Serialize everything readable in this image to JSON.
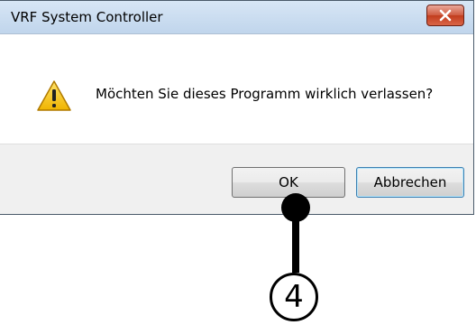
{
  "window": {
    "title": "VRF System Controller",
    "close_icon": "close-x-icon"
  },
  "dialog": {
    "icon": "warning-triangle-icon",
    "message": "Möchten Sie dieses Programm wirklich verlassen?"
  },
  "buttons": {
    "ok_label": "OK",
    "cancel_label": "Abbrechen"
  },
  "callout": {
    "number": "4"
  },
  "colors": {
    "titlebar": "#c9dcf0",
    "close_button": "#c94a2e",
    "footer": "#f0f0f0",
    "warning_yellow": "#f5c518"
  }
}
